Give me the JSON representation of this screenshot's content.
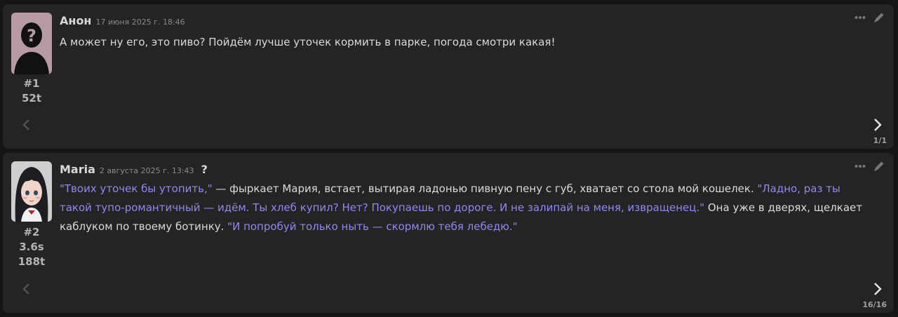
{
  "messages": [
    {
      "author": "Анон",
      "date": "17 июня 2025 г. 18:46",
      "index": "#1",
      "stats": [
        "52t"
      ],
      "avatar": "anonymous-silhouette",
      "parts": [
        {
          "text": "А может ну его, это пиво? Пойдём лучше уточек кормить в парке, погода смотри какая!",
          "quote": false
        }
      ],
      "counter": "1/1"
    },
    {
      "author": "Maria",
      "date": "2 августа 2025 г. 13:43",
      "help": "?",
      "index": "#2",
      "stats": [
        "3.6s",
        "188t"
      ],
      "avatar": "anime-girl-portrait",
      "parts": [
        {
          "text": "\"Твоих уточек бы утопить,\"",
          "quote": true
        },
        {
          "text": " — фыркает Мария, встает, вытирая ладонью пивную пену с губ, хватает со стола мой кошелек. ",
          "quote": false
        },
        {
          "text": "\"Ладно, раз ты такой тупо-романтичный — идём. Ты хлеб купил? Нет? Покупаешь по дороге. И не залипай на меня, извращенец.\"",
          "quote": true
        },
        {
          "text": " Она уже в дверях, щелкает каблуком по твоему ботинку. ",
          "quote": false
        },
        {
          "text": "\"И попробуй только ныть — скормлю тебя лебедю.\"",
          "quote": true
        }
      ],
      "counter": "16/16"
    }
  ],
  "icons": {
    "more": "more-dots-icon",
    "edit": "pencil-icon",
    "prev": "chevron-left-icon",
    "next": "chevron-right-icon"
  },
  "colors": {
    "background": "#151515",
    "card": "#242424",
    "quote": "#8e88f2",
    "text": "#dadada"
  }
}
